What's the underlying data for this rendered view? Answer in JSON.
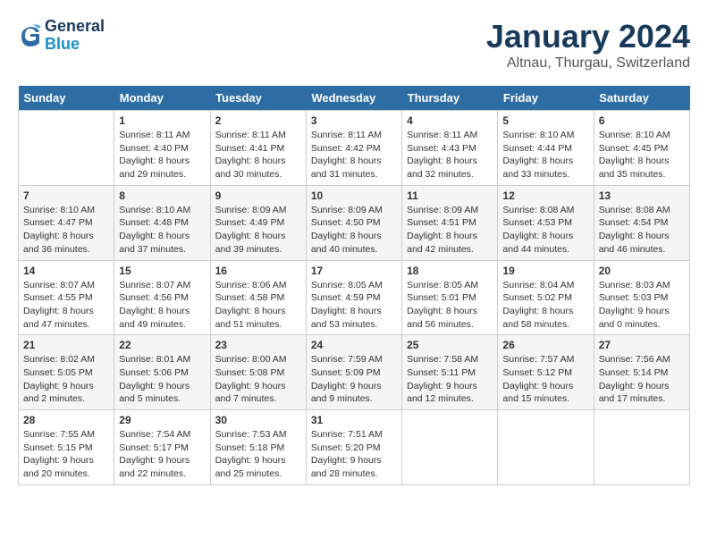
{
  "logo": {
    "line1": "General",
    "line2": "Blue"
  },
  "title": "January 2024",
  "subtitle": "Altnau, Thurgau, Switzerland",
  "days_header": [
    "Sunday",
    "Monday",
    "Tuesday",
    "Wednesday",
    "Thursday",
    "Friday",
    "Saturday"
  ],
  "weeks": [
    [
      {
        "num": "",
        "info": ""
      },
      {
        "num": "1",
        "info": "Sunrise: 8:11 AM\nSunset: 4:40 PM\nDaylight: 8 hours\nand 29 minutes."
      },
      {
        "num": "2",
        "info": "Sunrise: 8:11 AM\nSunset: 4:41 PM\nDaylight: 8 hours\nand 30 minutes."
      },
      {
        "num": "3",
        "info": "Sunrise: 8:11 AM\nSunset: 4:42 PM\nDaylight: 8 hours\nand 31 minutes."
      },
      {
        "num": "4",
        "info": "Sunrise: 8:11 AM\nSunset: 4:43 PM\nDaylight: 8 hours\nand 32 minutes."
      },
      {
        "num": "5",
        "info": "Sunrise: 8:10 AM\nSunset: 4:44 PM\nDaylight: 8 hours\nand 33 minutes."
      },
      {
        "num": "6",
        "info": "Sunrise: 8:10 AM\nSunset: 4:45 PM\nDaylight: 8 hours\nand 35 minutes."
      }
    ],
    [
      {
        "num": "7",
        "info": "Sunrise: 8:10 AM\nSunset: 4:47 PM\nDaylight: 8 hours\nand 36 minutes."
      },
      {
        "num": "8",
        "info": "Sunrise: 8:10 AM\nSunset: 4:48 PM\nDaylight: 8 hours\nand 37 minutes."
      },
      {
        "num": "9",
        "info": "Sunrise: 8:09 AM\nSunset: 4:49 PM\nDaylight: 8 hours\nand 39 minutes."
      },
      {
        "num": "10",
        "info": "Sunrise: 8:09 AM\nSunset: 4:50 PM\nDaylight: 8 hours\nand 40 minutes."
      },
      {
        "num": "11",
        "info": "Sunrise: 8:09 AM\nSunset: 4:51 PM\nDaylight: 8 hours\nand 42 minutes."
      },
      {
        "num": "12",
        "info": "Sunrise: 8:08 AM\nSunset: 4:53 PM\nDaylight: 8 hours\nand 44 minutes."
      },
      {
        "num": "13",
        "info": "Sunrise: 8:08 AM\nSunset: 4:54 PM\nDaylight: 8 hours\nand 46 minutes."
      }
    ],
    [
      {
        "num": "14",
        "info": "Sunrise: 8:07 AM\nSunset: 4:55 PM\nDaylight: 8 hours\nand 47 minutes."
      },
      {
        "num": "15",
        "info": "Sunrise: 8:07 AM\nSunset: 4:56 PM\nDaylight: 8 hours\nand 49 minutes."
      },
      {
        "num": "16",
        "info": "Sunrise: 8:06 AM\nSunset: 4:58 PM\nDaylight: 8 hours\nand 51 minutes."
      },
      {
        "num": "17",
        "info": "Sunrise: 8:05 AM\nSunset: 4:59 PM\nDaylight: 8 hours\nand 53 minutes."
      },
      {
        "num": "18",
        "info": "Sunrise: 8:05 AM\nSunset: 5:01 PM\nDaylight: 8 hours\nand 56 minutes."
      },
      {
        "num": "19",
        "info": "Sunrise: 8:04 AM\nSunset: 5:02 PM\nDaylight: 8 hours\nand 58 minutes."
      },
      {
        "num": "20",
        "info": "Sunrise: 8:03 AM\nSunset: 5:03 PM\nDaylight: 9 hours\nand 0 minutes."
      }
    ],
    [
      {
        "num": "21",
        "info": "Sunrise: 8:02 AM\nSunset: 5:05 PM\nDaylight: 9 hours\nand 2 minutes."
      },
      {
        "num": "22",
        "info": "Sunrise: 8:01 AM\nSunset: 5:06 PM\nDaylight: 9 hours\nand 5 minutes."
      },
      {
        "num": "23",
        "info": "Sunrise: 8:00 AM\nSunset: 5:08 PM\nDaylight: 9 hours\nand 7 minutes."
      },
      {
        "num": "24",
        "info": "Sunrise: 7:59 AM\nSunset: 5:09 PM\nDaylight: 9 hours\nand 9 minutes."
      },
      {
        "num": "25",
        "info": "Sunrise: 7:58 AM\nSunset: 5:11 PM\nDaylight: 9 hours\nand 12 minutes."
      },
      {
        "num": "26",
        "info": "Sunrise: 7:57 AM\nSunset: 5:12 PM\nDaylight: 9 hours\nand 15 minutes."
      },
      {
        "num": "27",
        "info": "Sunrise: 7:56 AM\nSunset: 5:14 PM\nDaylight: 9 hours\nand 17 minutes."
      }
    ],
    [
      {
        "num": "28",
        "info": "Sunrise: 7:55 AM\nSunset: 5:15 PM\nDaylight: 9 hours\nand 20 minutes."
      },
      {
        "num": "29",
        "info": "Sunrise: 7:54 AM\nSunset: 5:17 PM\nDaylight: 9 hours\nand 22 minutes."
      },
      {
        "num": "30",
        "info": "Sunrise: 7:53 AM\nSunset: 5:18 PM\nDaylight: 9 hours\nand 25 minutes."
      },
      {
        "num": "31",
        "info": "Sunrise: 7:51 AM\nSunset: 5:20 PM\nDaylight: 9 hours\nand 28 minutes."
      },
      {
        "num": "",
        "info": ""
      },
      {
        "num": "",
        "info": ""
      },
      {
        "num": "",
        "info": ""
      }
    ]
  ]
}
